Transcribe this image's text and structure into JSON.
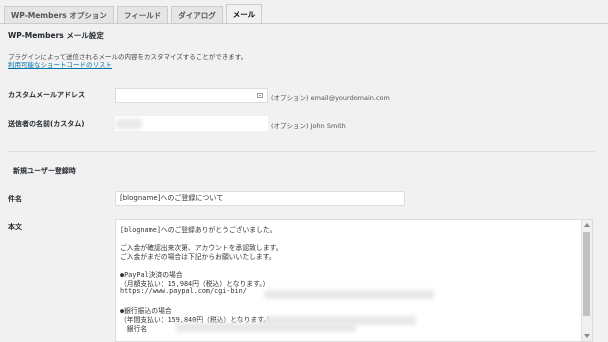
{
  "tabs": [
    {
      "label": "WP-Members オプション"
    },
    {
      "label": "フィールド"
    },
    {
      "label": "ダイアログ"
    },
    {
      "label": "メール"
    }
  ],
  "heading": "WP-Members メール設定",
  "description": "プラグインによって送信されるメールの内容をカスタマイズすることができます。",
  "shortcode_link": "利用可能なショートコードのリスト",
  "custom_address": {
    "label": "カスタムメールアドレス",
    "hint": "(オプション) email@yourdomain.com",
    "icon": "contact-card-icon"
  },
  "sender_name": {
    "label": "送信者の名前(カスタム)",
    "hint": "(オプション) John Smith"
  },
  "section_title": "新規ユーザー登録時",
  "subject": {
    "label": "件名",
    "value": "[blogname]へのご登録について"
  },
  "body": {
    "label": "本文",
    "lines": [
      "[blogname]へのご登録ありがとうございました。",
      "",
      "ご入金が確認出来次第、アカウントを承認致します。",
      "ご入金がまだの場合は下記からお願いいたします。",
      "",
      "●PayPal決済の場合",
      "（月額支払い：15,984円（税込）となります。）",
      "https://www.paypal.com/cgi-bin/",
      "",
      "●銀行振込の場合",
      "（年間支払い：159,840円（税込）となります。）",
      "　銀行名"
    ]
  }
}
